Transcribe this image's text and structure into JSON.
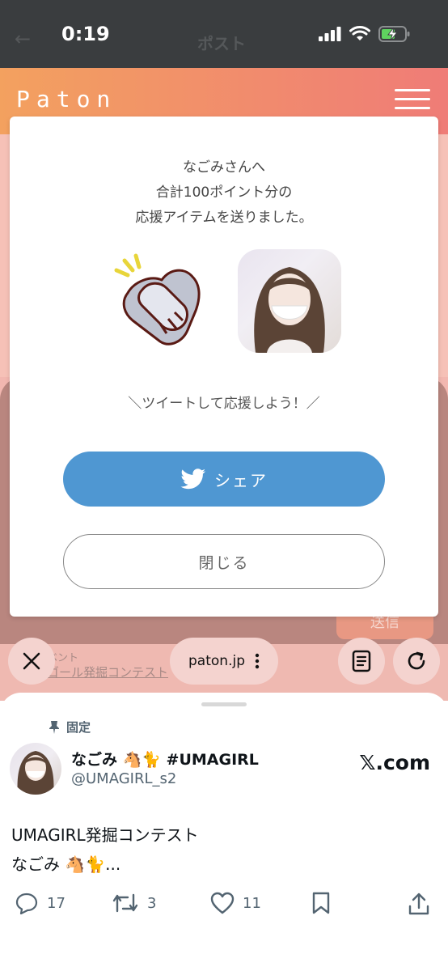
{
  "status_bar": {
    "time": "0:19",
    "ghost_title": "ポスト"
  },
  "header": {
    "logo": "Paton"
  },
  "background": {
    "send_label": "送信",
    "event_label": "ベント",
    "contest_link": "ゴール発掘コンテスト"
  },
  "modal": {
    "message_line1": "なごみさんへ",
    "message_line2": "合計100ポイント分の",
    "message_line3": "応援アイテムを送りました。",
    "cta": "＼ツイートして応援しよう！／",
    "share_label": "シェア",
    "close_label": "閉じる"
  },
  "browser": {
    "url": "paton.jp"
  },
  "tweet": {
    "pinned_label": "固定",
    "name": "なごみ 🐴🐈 #UMAGIRL",
    "handle": "@UMAGIRL_s2",
    "source": "𝕏.com",
    "text_line1": "UMAGIRL発掘コンテスト",
    "text_line2": "なごみ 🐴🐈...",
    "replies": "17",
    "retweets": "3",
    "likes": "11"
  },
  "colors": {
    "accent_blue": "#4f97d2",
    "header_orange": "#f3a15f",
    "header_pink": "#ef7c77"
  }
}
